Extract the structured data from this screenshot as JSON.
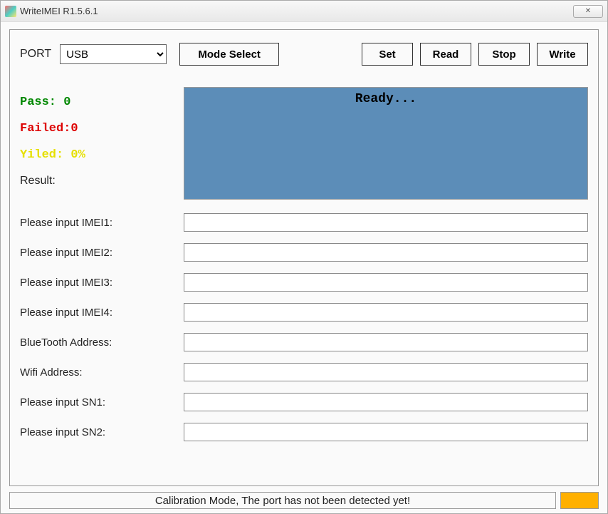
{
  "window": {
    "title": "WriteIMEI R1.5.6.1",
    "close_symbol": "✕"
  },
  "toolbar": {
    "port_label": "PORT",
    "port_value": "USB",
    "mode_select": "Mode Select",
    "set": "Set",
    "read": "Read",
    "stop": "Stop",
    "write": "Write"
  },
  "stats": {
    "pass_label": "Pass:",
    "pass_value": "0",
    "failed_label": "Failed:",
    "failed_value": "0",
    "yiled_label": "Yiled:",
    "yiled_value": "0%",
    "result_label": "Result:"
  },
  "status": {
    "text": "Ready..."
  },
  "inputs": {
    "imei1_label": "Please input IMEI1:",
    "imei1_value": "",
    "imei2_label": "Please input IMEI2:",
    "imei2_value": "",
    "imei3_label": "Please input IMEI3:",
    "imei3_value": "",
    "imei4_label": "Please input IMEI4:",
    "imei4_value": "",
    "bluetooth_label": "BlueTooth Address:",
    "bluetooth_value": "",
    "wifi_label": "Wifi Address:",
    "wifi_value": "",
    "sn1_label": "Please input SN1:",
    "sn1_value": "",
    "sn2_label": "Please input SN2:",
    "sn2_value": ""
  },
  "footer": {
    "message": "Calibration Mode, The port has not been detected yet!",
    "indicator_color": "#ffb000"
  }
}
